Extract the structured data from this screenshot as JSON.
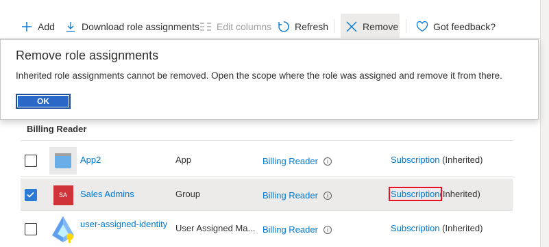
{
  "toolbar": {
    "add": "Add",
    "download": "Download role assignments",
    "edit_columns": "Edit columns",
    "refresh": "Refresh",
    "remove": "Remove",
    "feedback": "Got feedback?"
  },
  "dialog": {
    "title": "Remove role assignments",
    "message": "Inherited role assignments cannot be removed. Open the scope where the role was assigned and remove it from there.",
    "ok_label": "OK"
  },
  "group": {
    "label": "Billing Reader"
  },
  "rows": [
    {
      "name": "App2",
      "type": "App",
      "role": "Billing Reader",
      "scope": "Subscription",
      "inherited": "(Inherited)",
      "checked": false,
      "icon": "app-icon"
    },
    {
      "name": "Sales Admins",
      "type": "Group",
      "role": "Billing Reader",
      "scope": "Subscription",
      "inherited": "(Inherited)",
      "checked": true,
      "icon": "group-initials",
      "initials": "SA"
    },
    {
      "name": "user-assigned-identity",
      "type": "User Assigned Ma...",
      "role": "Billing Reader",
      "scope": "Subscription",
      "inherited": "(Inherited)",
      "checked": false,
      "icon": "managed-identity-icon"
    }
  ],
  "colors": {
    "accent": "#0078d4",
    "highlight": "#e81123",
    "group_avatar": "#d13438"
  }
}
